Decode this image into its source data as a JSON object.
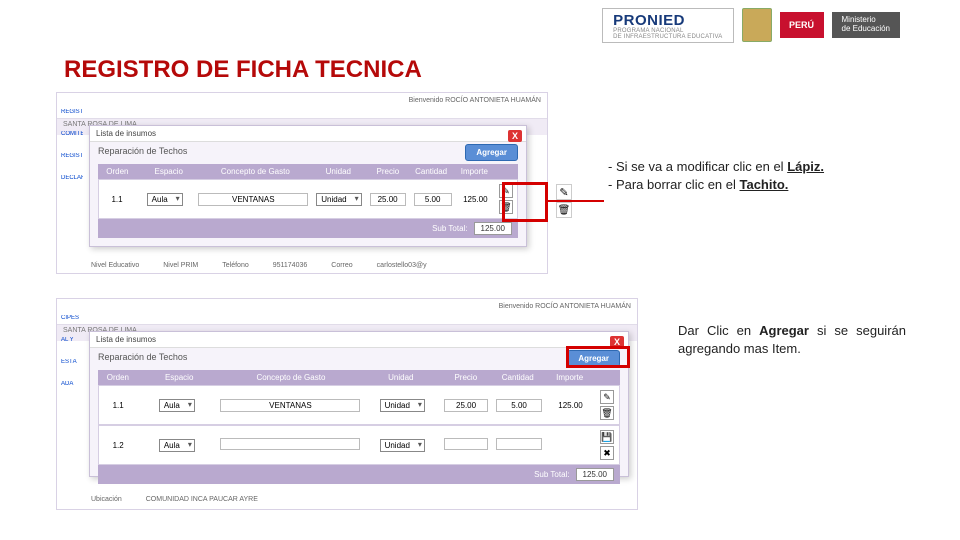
{
  "header": {
    "pronied_title": "PRONIED",
    "pronied_sub1": "PROGRAMA NACIONAL",
    "pronied_sub2": "DE INFRAESTRUCTURA EDUCATIVA",
    "peru": "PERÚ",
    "minedu1": "Ministerio",
    "minedu2": "de Educación"
  },
  "slide_title": "REGISTRO DE FICHA TECNICA",
  "frame1": {
    "crumb": "SANTA ROSA DE LIMA",
    "welcome": "Bienvenido    ROCÍO ANTONIETA HUAMÁN",
    "side": [
      "REGISTRO F",
      "COMITÉ Y",
      "REGISTRO",
      "DECLARA"
    ],
    "modal": {
      "listbar": "Lista de insumos",
      "subtitle": "Reparación de Techos",
      "agregar": "Agregar",
      "headers": [
        "Orden",
        "Espacio",
        "Concepto de Gasto",
        "Unidad",
        "Precio",
        "Cantidad",
        "Importe",
        ""
      ],
      "widths": [
        42,
        70,
        120,
        62,
        46,
        48,
        46,
        24
      ],
      "rows": [
        {
          "orden": "1.1",
          "espacio": "Aula",
          "concepto": "VENTANAS",
          "unidad": "Unidad",
          "precio": "25.00",
          "cantidad": "5.00",
          "importe": "125.00"
        }
      ],
      "subtotal_label": "Sub Total:",
      "subtotal_value": "125.00"
    },
    "strip_labels": [
      "Nivel Educativo",
      "Nivel PRIM",
      "Teléfono",
      "951174036",
      "Correo",
      "carlostello03@y"
    ]
  },
  "frame2": {
    "crumb": "SANTA ROSA DE LIMA",
    "welcome": "Bienvenido    ROCÍO ANTONIETA HUAMÁN",
    "side": [
      "CIPES",
      "AL Y",
      "ESTÁ",
      "ADA"
    ],
    "modal": {
      "listbar": "Lista de insumos",
      "subtitle": "Reparación de Techos",
      "agregar": "Agregar",
      "headers": [
        "Orden",
        "Espacio",
        "Concepto de Gasto",
        "Unidad",
        "Precio",
        "Cantidad",
        "Importe",
        ""
      ],
      "widths": [
        42,
        88,
        150,
        84,
        54,
        56,
        54,
        26
      ],
      "rows": [
        {
          "orden": "1.1",
          "espacio": "Aula",
          "concepto": "VENTANAS",
          "unidad": "Unidad",
          "precio": "25.00",
          "cantidad": "5.00",
          "importe": "125.00"
        },
        {
          "orden": "1.2",
          "espacio": "Aula",
          "concepto": "",
          "unidad": "Unidad",
          "precio": "",
          "cantidad": "",
          "importe": ""
        }
      ],
      "subtotal_label": "Sub Total:",
      "subtotal_value": "125.00"
    },
    "strip_labels": [
      "Ubicación",
      "COMUNIDAD INCA PAUCAR AYRE"
    ]
  },
  "notes": {
    "n1_a": "- Si se va a modificar clic en el ",
    "n1_b": "Lápiz.",
    "n1_c": "- Para borrar clic en el ",
    "n1_d": "Tachito.",
    "n2_a": "Dar Clic en ",
    "n2_b": "Agregar",
    "n2_c": " si se seguirán agregando mas Item."
  },
  "icons": {
    "edit": "✎",
    "delete": "🗑",
    "disk": "💾",
    "cancel": "✖"
  }
}
